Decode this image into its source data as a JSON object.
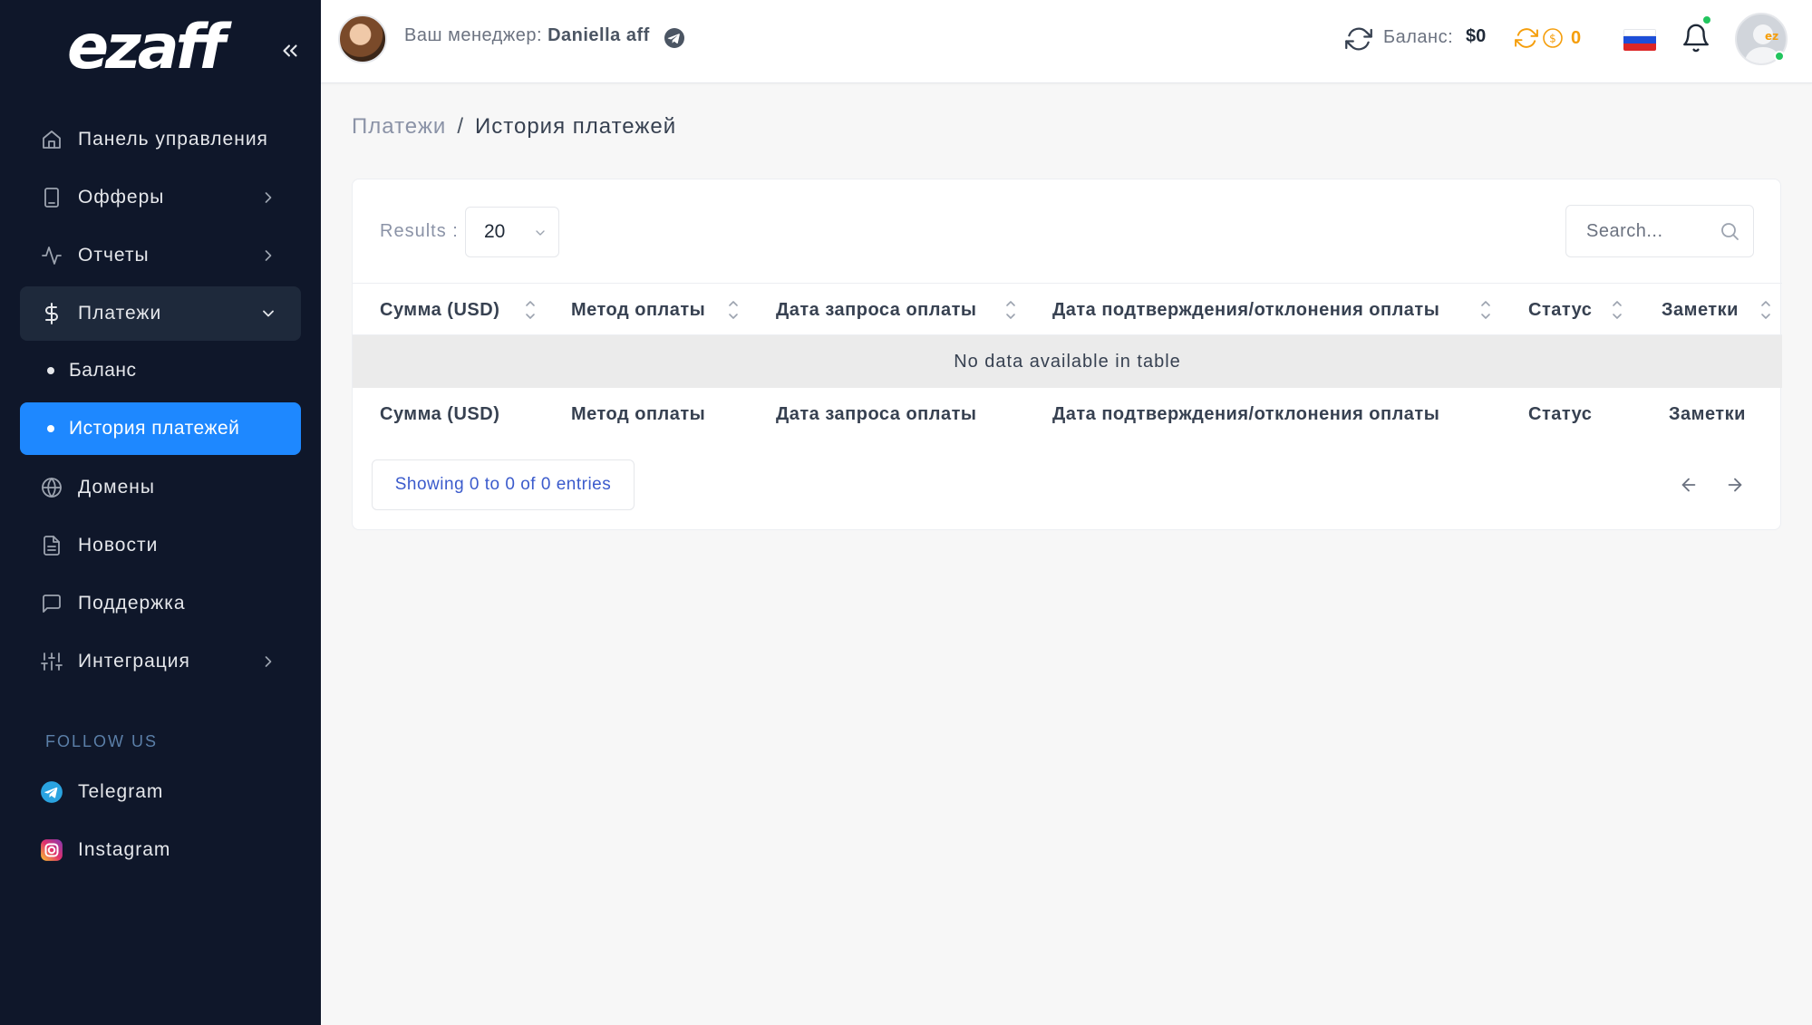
{
  "sidebar": {
    "logo_text": "ezaff",
    "items": [
      {
        "label": "Панель управления",
        "icon": "home-icon"
      },
      {
        "label": "Офферы",
        "icon": "tablet-icon"
      },
      {
        "label": "Отчеты",
        "icon": "activity-icon"
      },
      {
        "label": "Платежи",
        "icon": "dollar-icon"
      },
      {
        "label": "Домены",
        "icon": "globe-icon"
      },
      {
        "label": "Новости",
        "icon": "document-icon"
      },
      {
        "label": "Поддержка",
        "icon": "message-icon"
      },
      {
        "label": "Интеграция",
        "icon": "sliders-icon"
      }
    ],
    "payments_sub": [
      {
        "label": "Баланс"
      },
      {
        "label": "История платежей"
      }
    ],
    "follow_label": "FOLLOW US",
    "social": [
      {
        "label": "Telegram",
        "icon": "telegram-icon"
      },
      {
        "label": "Instagram",
        "icon": "instagram-icon"
      }
    ]
  },
  "topbar": {
    "manager_prefix": "Ваш менеджер:",
    "manager_name": "Daniella aff",
    "balance_label": "Баланс:",
    "balance_value": "$0",
    "coins_value": "0",
    "language": "ru"
  },
  "breadcrumb": {
    "parent": "Платежи",
    "separator": "/",
    "current": "История платежей"
  },
  "table": {
    "results_label": "Results :",
    "results_value": "20",
    "search_placeholder": "Search...",
    "columns": [
      "Сумма (USD)",
      "Метод оплаты",
      "Дата запроса оплаты",
      "Дата подтверждения/отклонения оплаты",
      "Статус",
      "Заметки"
    ],
    "empty_message": "No data available in table",
    "info": "Showing 0 to 0 of 0 entries"
  },
  "colors": {
    "sidebar_bg": "#0f172a",
    "active_item": "#1e88ff",
    "accent_link": "#3b5bcc",
    "coin": "#f59e0b"
  }
}
